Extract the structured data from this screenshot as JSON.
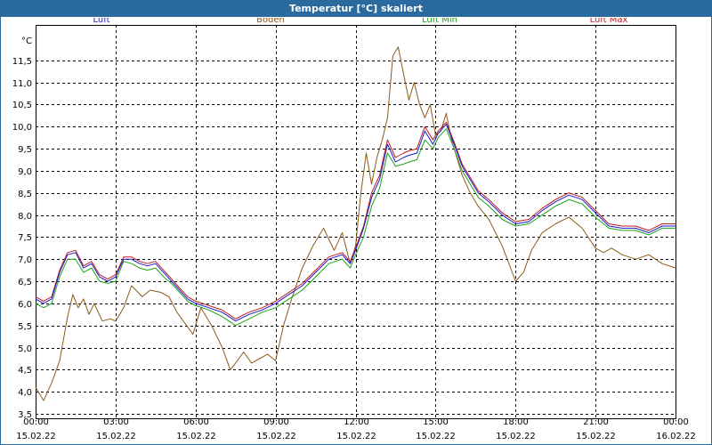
{
  "window": {
    "title": "Temperatur [°C] skaliert"
  },
  "chart_data": {
    "type": "line",
    "title": "Temperatur [°C] skaliert",
    "ylabel": "°C",
    "xlabel": "",
    "ylim": [
      3.4,
      12.3
    ],
    "yticks": [
      3.5,
      4.0,
      4.5,
      5.0,
      5.5,
      6.0,
      6.5,
      7.0,
      7.5,
      8.0,
      8.5,
      9.0,
      9.5,
      10.0,
      10.5,
      11.0,
      11.5
    ],
    "ytick_labels": [
      "3,5",
      "4,0",
      "4,5",
      "5,0",
      "5,5",
      "6,0",
      "6,5",
      "7,0",
      "7,5",
      "8,0",
      "8,5",
      "9,0",
      "9,5",
      "10,0",
      "10,5",
      "11,0",
      "11,5"
    ],
    "xlim_hours": [
      0,
      24
    ],
    "xticks": [
      {
        "h": 0,
        "time": "00:00",
        "date": "15.02.22"
      },
      {
        "h": 3,
        "time": "03:00",
        "date": "15.02.22"
      },
      {
        "h": 6,
        "time": "06:00",
        "date": "15.02.22"
      },
      {
        "h": 9,
        "time": "09:00",
        "date": "15.02.22"
      },
      {
        "h": 12,
        "time": "12:00",
        "date": "15.02.22"
      },
      {
        "h": 15,
        "time": "15:00",
        "date": "15.02.22"
      },
      {
        "h": 18,
        "time": "18:00",
        "date": "15.02.22"
      },
      {
        "h": 21,
        "time": "21:00",
        "date": "15.02.22"
      },
      {
        "h": 24,
        "time": "00:00",
        "date": "16.02.22"
      }
    ],
    "grid": true,
    "legend_position": "top",
    "series": [
      {
        "name": "Luft",
        "color": "#1a1ad0",
        "x": [
          0,
          0.3,
          0.6,
          0.9,
          1.2,
          1.5,
          1.8,
          2.1,
          2.4,
          2.7,
          3,
          3.3,
          3.6,
          3.9,
          4.2,
          4.5,
          4.8,
          5.1,
          5.4,
          5.7,
          6,
          6.5,
          7,
          7.5,
          8,
          8.5,
          9,
          9.5,
          10,
          10.5,
          11,
          11.5,
          11.8,
          12,
          12.3,
          12.6,
          12.9,
          13.2,
          13.5,
          13.8,
          14,
          14.3,
          14.6,
          14.9,
          15.1,
          15.4,
          15.7,
          16,
          16.3,
          16.6,
          17,
          17.5,
          18,
          18.5,
          19,
          19.5,
          20,
          20.5,
          21,
          21.5,
          22,
          22.5,
          23,
          23.5,
          24
        ],
        "values": [
          6.1,
          6.0,
          6.1,
          6.7,
          7.1,
          7.15,
          6.8,
          6.9,
          6.6,
          6.5,
          6.6,
          7.0,
          7.0,
          6.9,
          6.85,
          6.9,
          6.7,
          6.5,
          6.3,
          6.1,
          6.0,
          5.9,
          5.8,
          5.6,
          5.75,
          5.85,
          6.0,
          6.2,
          6.4,
          6.7,
          7.0,
          7.1,
          6.9,
          7.2,
          7.7,
          8.4,
          8.8,
          9.6,
          9.2,
          9.3,
          9.35,
          9.4,
          9.9,
          9.6,
          9.85,
          10.05,
          9.6,
          9.1,
          8.8,
          8.5,
          8.3,
          8.0,
          7.8,
          7.85,
          8.1,
          8.3,
          8.45,
          8.35,
          8.05,
          7.75,
          7.7,
          7.7,
          7.6,
          7.75,
          7.75
        ]
      },
      {
        "name": "Boden",
        "color": "#8b5a1a",
        "x": [
          0,
          0.3,
          0.6,
          0.9,
          1.2,
          1.4,
          1.6,
          1.8,
          2.0,
          2.2,
          2.5,
          2.8,
          3.0,
          3.3,
          3.6,
          4.0,
          4.3,
          4.7,
          5.0,
          5.3,
          5.6,
          5.9,
          6.2,
          6.6,
          7.0,
          7.3,
          7.5,
          7.8,
          8.1,
          8.4,
          8.7,
          9.0,
          9.3,
          9.6,
          10.0,
          10.4,
          10.8,
          11.2,
          11.5,
          11.8,
          12.0,
          12.2,
          12.4,
          12.6,
          12.8,
          13.0,
          13.2,
          13.4,
          13.6,
          13.8,
          14.0,
          14.2,
          14.4,
          14.6,
          14.8,
          15.0,
          15.2,
          15.4,
          15.6,
          15.8,
          16.0,
          16.3,
          16.6,
          17.0,
          17.5,
          18.0,
          18.3,
          18.6,
          19.0,
          19.5,
          20.0,
          20.5,
          21.0,
          21.3,
          21.6,
          22.0,
          22.5,
          23.0,
          23.5,
          24.0
        ],
        "values": [
          4.1,
          3.8,
          4.2,
          4.7,
          5.7,
          6.2,
          5.9,
          6.1,
          5.75,
          6.0,
          5.6,
          5.65,
          5.6,
          5.9,
          6.4,
          6.15,
          6.3,
          6.25,
          6.15,
          5.8,
          5.55,
          5.3,
          5.9,
          5.5,
          5.0,
          4.5,
          4.65,
          4.9,
          4.65,
          4.75,
          4.85,
          4.7,
          5.5,
          6.1,
          6.8,
          7.3,
          7.7,
          7.2,
          7.6,
          6.9,
          7.3,
          8.5,
          9.4,
          8.7,
          9.3,
          9.7,
          10.2,
          11.6,
          11.8,
          11.2,
          10.6,
          11.0,
          10.5,
          10.2,
          10.5,
          9.8,
          9.9,
          10.3,
          9.7,
          9.3,
          8.9,
          8.5,
          8.2,
          7.9,
          7.3,
          6.5,
          6.7,
          7.2,
          7.6,
          7.8,
          7.95,
          7.7,
          7.25,
          7.15,
          7.25,
          7.1,
          7.0,
          7.1,
          6.9,
          6.8
        ]
      },
      {
        "name": "Luft Min",
        "color": "#1aa01a",
        "x": [
          0,
          0.3,
          0.6,
          0.9,
          1.2,
          1.5,
          1.8,
          2.1,
          2.4,
          2.7,
          3,
          3.3,
          3.6,
          3.9,
          4.2,
          4.5,
          4.8,
          5.1,
          5.4,
          5.7,
          6,
          6.5,
          7,
          7.5,
          8,
          8.5,
          9,
          9.5,
          10,
          10.5,
          11,
          11.5,
          11.8,
          12,
          12.3,
          12.6,
          12.9,
          13.2,
          13.5,
          13.8,
          14,
          14.3,
          14.6,
          14.9,
          15.1,
          15.4,
          15.7,
          16,
          16.3,
          16.6,
          17,
          17.5,
          18,
          18.5,
          19,
          19.5,
          20,
          20.5,
          21,
          21.5,
          22,
          22.5,
          23,
          23.5,
          24
        ],
        "values": [
          6.0,
          5.9,
          6.0,
          6.6,
          7.0,
          7.0,
          6.7,
          6.8,
          6.5,
          6.45,
          6.5,
          6.95,
          6.9,
          6.8,
          6.75,
          6.8,
          6.6,
          6.45,
          6.25,
          6.05,
          5.95,
          5.85,
          5.7,
          5.5,
          5.65,
          5.8,
          5.9,
          6.1,
          6.3,
          6.6,
          6.9,
          7.0,
          6.8,
          7.1,
          7.5,
          8.2,
          8.6,
          9.4,
          9.1,
          9.15,
          9.2,
          9.25,
          9.7,
          9.5,
          9.75,
          9.95,
          9.5,
          9.0,
          8.7,
          8.4,
          8.2,
          7.9,
          7.75,
          7.8,
          8.0,
          8.2,
          8.35,
          8.25,
          7.95,
          7.7,
          7.65,
          7.65,
          7.55,
          7.7,
          7.7
        ]
      },
      {
        "name": "Luft Max",
        "color": "#c01a1a",
        "x": [
          0,
          0.3,
          0.6,
          0.9,
          1.2,
          1.5,
          1.8,
          2.1,
          2.4,
          2.7,
          3,
          3.3,
          3.6,
          3.9,
          4.2,
          4.5,
          4.8,
          5.1,
          5.4,
          5.7,
          6,
          6.5,
          7,
          7.5,
          8,
          8.5,
          9,
          9.5,
          10,
          10.5,
          11,
          11.5,
          11.8,
          12,
          12.3,
          12.6,
          12.9,
          13.2,
          13.5,
          13.8,
          14,
          14.3,
          14.6,
          14.9,
          15.1,
          15.4,
          15.7,
          16,
          16.3,
          16.6,
          17,
          17.5,
          18,
          18.5,
          19,
          19.5,
          20,
          20.5,
          21,
          21.5,
          22,
          22.5,
          23,
          23.5,
          24
        ],
        "values": [
          6.15,
          6.05,
          6.15,
          6.75,
          7.15,
          7.2,
          6.85,
          6.95,
          6.65,
          6.55,
          6.65,
          7.05,
          7.05,
          6.95,
          6.9,
          6.95,
          6.75,
          6.55,
          6.35,
          6.15,
          6.05,
          5.95,
          5.85,
          5.65,
          5.8,
          5.9,
          6.05,
          6.25,
          6.45,
          6.75,
          7.05,
          7.15,
          6.95,
          7.25,
          7.75,
          8.5,
          8.9,
          9.7,
          9.3,
          9.4,
          9.45,
          9.5,
          10.0,
          9.7,
          9.9,
          10.1,
          9.65,
          9.15,
          8.85,
          8.55,
          8.35,
          8.05,
          7.85,
          7.9,
          8.15,
          8.35,
          8.5,
          8.4,
          8.1,
          7.8,
          7.75,
          7.75,
          7.65,
          7.8,
          7.8
        ]
      }
    ]
  }
}
